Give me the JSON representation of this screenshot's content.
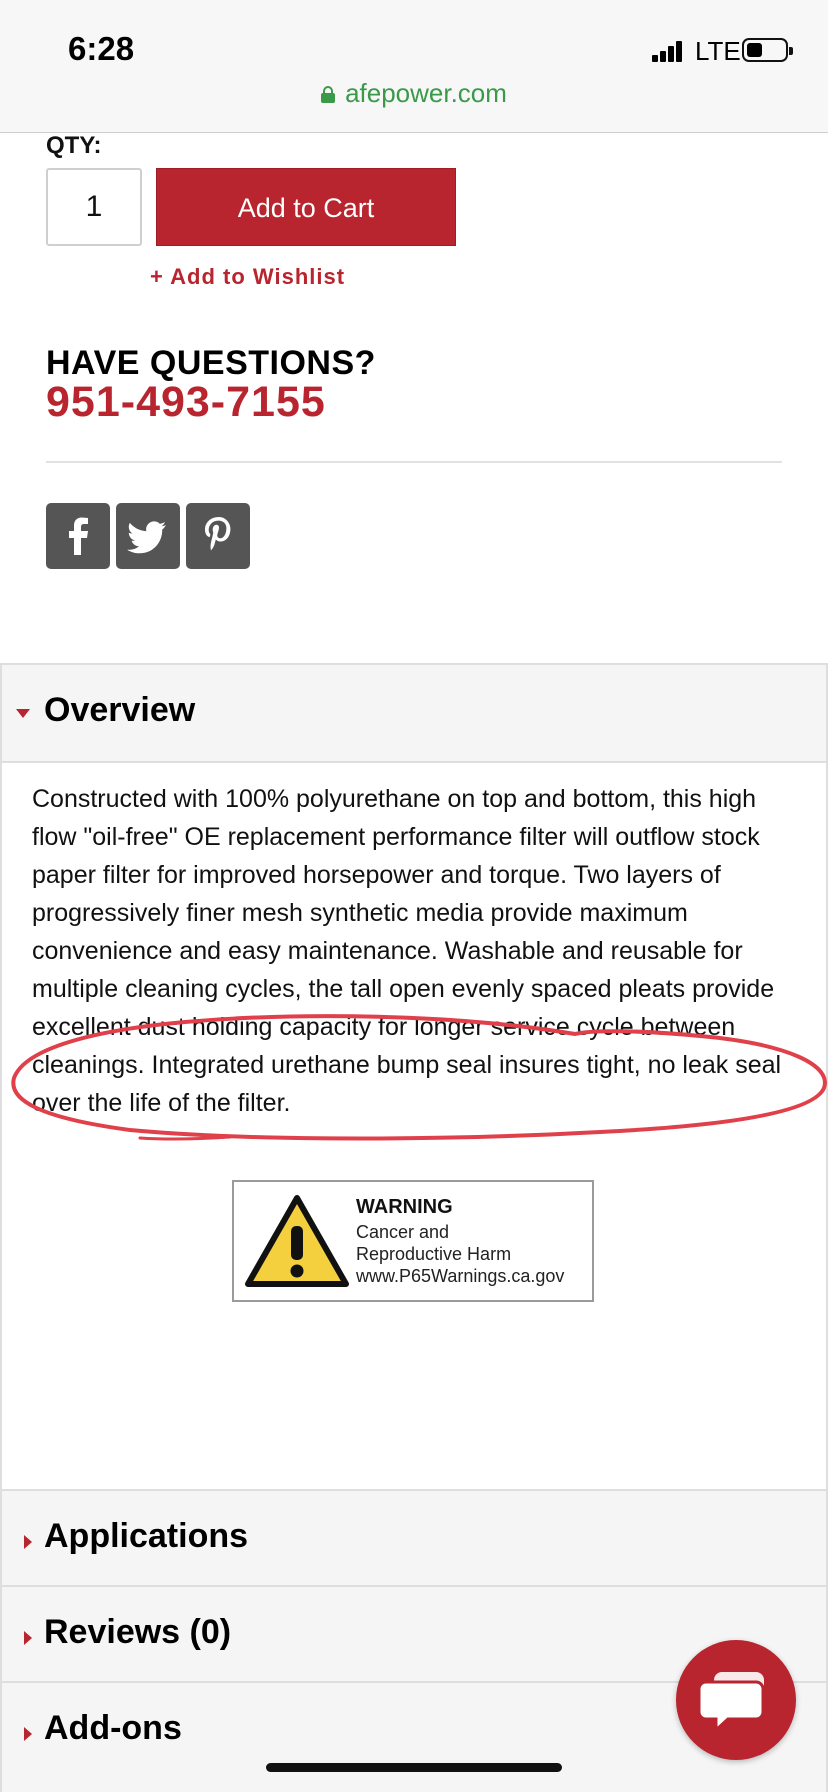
{
  "status_bar": {
    "time": "6:28",
    "network": "LTE",
    "battery_level": 0.4
  },
  "browser": {
    "url": "afepower.com"
  },
  "purchase": {
    "qty_label": "QTY:",
    "qty_value": "1",
    "add_to_cart_label": "Add to Cart",
    "wishlist_label": "+ Add to Wishlist"
  },
  "contact": {
    "heading": "HAVE QUESTIONS?",
    "phone": "951-493-7155"
  },
  "social": {
    "icons": [
      "facebook-icon",
      "twitter-icon",
      "pinterest-icon"
    ]
  },
  "tabs": {
    "overview": {
      "title": "Overview",
      "expanded": true,
      "description": "Constructed with 100% polyurethane on top and bottom, this high flow \"oil-free\" OE replacement performance filter will outflow stock paper filter for improved horsepower and torque. Two layers of progressively finer mesh synthetic media provide maximum convenience and easy maintenance. Washable and reusable for multiple cleaning cycles, the tall open evenly spaced pleats provide excellent dust holding capacity for longer service cycle between cleanings. Integrated urethane bump seal insures tight, no leak seal over the life of the filter."
    },
    "applications": {
      "title": "Applications",
      "expanded": false
    },
    "reviews": {
      "title": "Reviews (0)",
      "expanded": false
    },
    "addons": {
      "title": "Add-ons",
      "expanded": false
    }
  },
  "warning_label": {
    "title": "WARNING",
    "line1": "Cancer and",
    "line2": "Reproductive  Harm",
    "line3": "www.P65Warnings.ca.gov"
  },
  "colors": {
    "brand_red": "#b8252e",
    "url_green": "#3a9a4a",
    "annotation_red": "#e0404a",
    "social_gray": "#555555"
  }
}
